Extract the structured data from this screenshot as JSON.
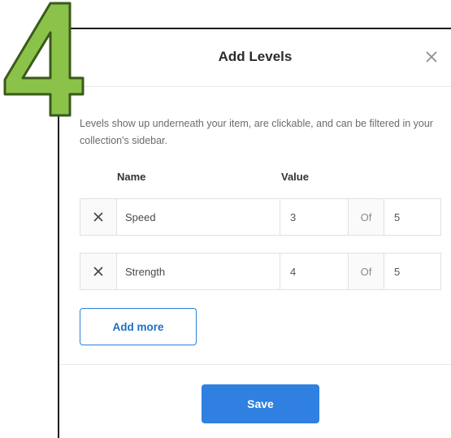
{
  "step_number": "4",
  "modal": {
    "title": "Add Levels",
    "close_icon": "close-icon",
    "description": "Levels show up underneath your item, are clickable, and can be filtered in your collection's sidebar.",
    "columns": {
      "name": "Name",
      "value": "Value"
    },
    "levels": [
      {
        "name": "Speed",
        "value": "3",
        "of_label": "Of",
        "max": "5"
      },
      {
        "name": "Strength",
        "value": "4",
        "of_label": "Of",
        "max": "5"
      }
    ],
    "add_more_label": "Add more",
    "save_label": "Save"
  },
  "colors": {
    "accent": "#2f80e0",
    "step_green": "#8bc34a"
  }
}
